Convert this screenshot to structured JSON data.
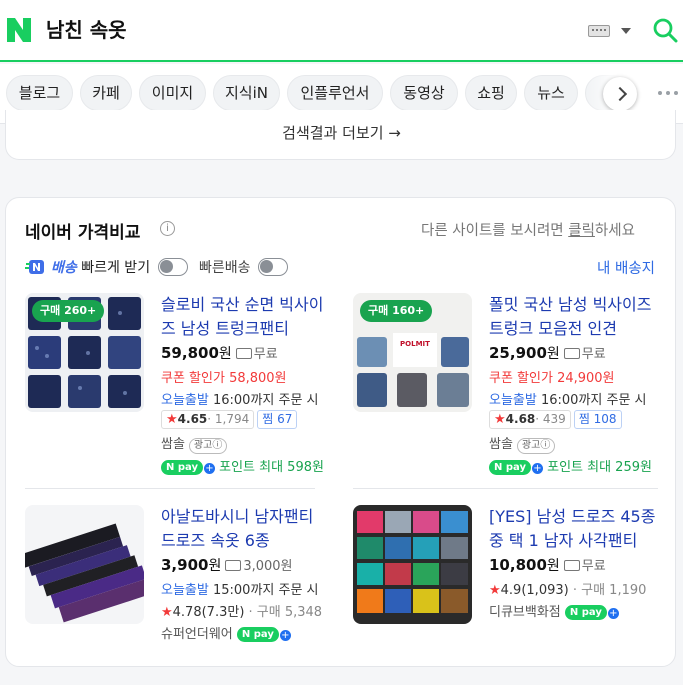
{
  "search": {
    "query": "남친 속옷"
  },
  "colors": {
    "brand": "#19ce60",
    "link": "#1d3bb0",
    "accent_blue": "#2f6be3",
    "sale_red": "#f23a3a",
    "npay_green": "#19ce60"
  },
  "tabs": [
    {
      "label": "블로그"
    },
    {
      "label": "카페"
    },
    {
      "label": "이미지"
    },
    {
      "label": "지식iN"
    },
    {
      "label": "인플루언서"
    },
    {
      "label": "동영상"
    },
    {
      "label": "쇼핑"
    },
    {
      "label": "뉴스"
    },
    {
      "label": "지"
    }
  ],
  "more_results": "검색결과 더보기 →",
  "price_compare": {
    "title": "네이버 가격비교",
    "info_icon": "i",
    "other_site_prefix": "다른 사이트를 보시려면 ",
    "other_site_link": "클릭",
    "other_site_suffix": "하세요",
    "nd_brand": "배송",
    "nd_text": "빠르게 받기",
    "fast_label": "빠른배송",
    "my_shipping": "내 배송지"
  },
  "products": [
    {
      "badge": "구매 260+",
      "title": "슬로비 국산 순면 빅사이즈 남성 트렁크팬티",
      "price": "59,800",
      "won": "원",
      "shipping": "무료",
      "coupon": "쿠폰 할인가 58,800원",
      "today_label": "오늘출발",
      "today_text": " 16:00까지 주문 시",
      "rating": "4.65",
      "reviews": "1,794",
      "jjim": "찜 67",
      "seller": "쌈솔",
      "ad": "광고ⓘ",
      "npay": "N pay",
      "point": "포인트 최대 598원"
    },
    {
      "badge": "구매 160+",
      "title": "폴밋 국산 남성 빅사이즈 트렁크 모음전 인견",
      "price": "25,900",
      "won": "원",
      "shipping": "무료",
      "coupon": "쿠폰 할인가 24,900원",
      "today_label": "오늘출발",
      "today_text": " 16:00까지 주문 시",
      "rating": "4.68",
      "reviews": "439",
      "jjim": "찜 108",
      "seller": "쌈솔",
      "ad": "광고ⓘ",
      "npay": "N pay",
      "point": "포인트 최대 259원",
      "thumb_text": "POLMIT"
    },
    {
      "title": "아날도바시니 남자팬티 드로즈 속옷 6종",
      "price": "3,900",
      "won": "원",
      "shipping": "3,000원",
      "today_label": "오늘출발",
      "today_text": " 15:00까지 주문 시",
      "rating": "4.78",
      "reviews": "(7.3만)",
      "purchases": "구매 5,348",
      "seller": "슈퍼언더웨어",
      "npay": "N pay"
    },
    {
      "title": "[YES] 남성 드로즈 45종 중 택 1 남자 사각팬티",
      "price": "10,800",
      "won": "원",
      "shipping": "무료",
      "rating": "4.9",
      "reviews": "(1,093)",
      "purchases": "구매 1,190",
      "seller": "디큐브백화점",
      "npay": "N pay"
    }
  ]
}
